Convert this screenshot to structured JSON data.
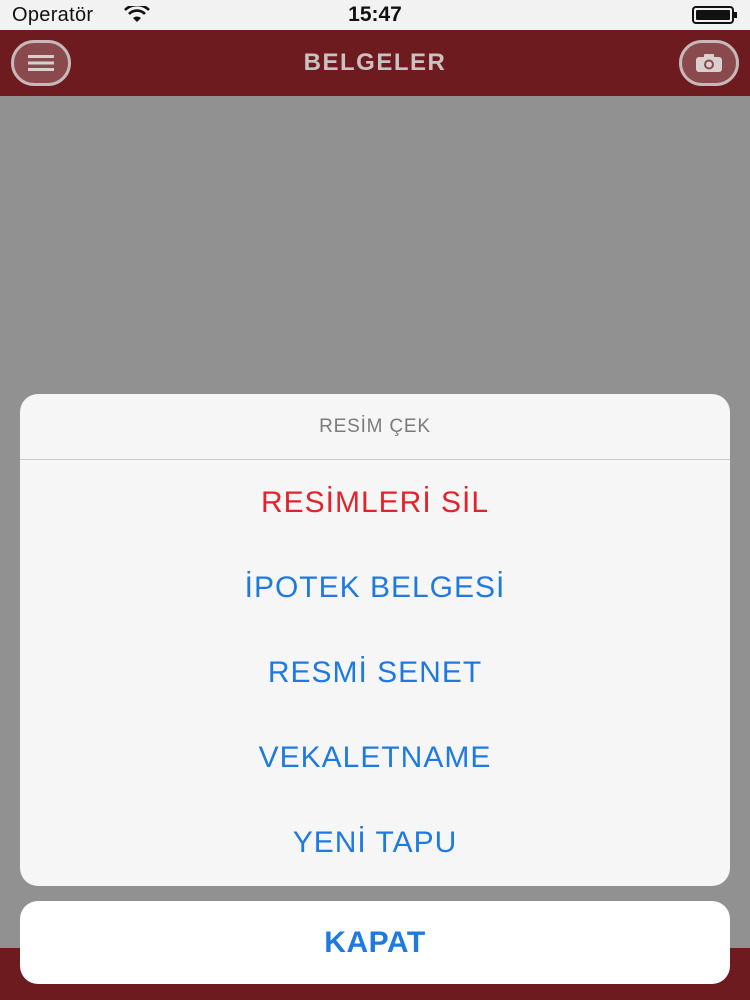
{
  "status_bar": {
    "carrier": "Operatör",
    "time": "15:47",
    "wifi_icon": "wifi-icon",
    "battery_icon": "battery-icon"
  },
  "nav_bar": {
    "title": "BELGELER",
    "left_icon": "menu-icon",
    "right_icon": "camera-icon",
    "background_color": "#6e1b1f"
  },
  "action_sheet": {
    "title": "RESİM ÇEK",
    "items": [
      {
        "label": "RESİMLERİ SİL",
        "style": "destructive"
      },
      {
        "label": "İPOTEK BELGESİ",
        "style": "default"
      },
      {
        "label": "RESMİ SENET",
        "style": "default"
      },
      {
        "label": "VEKALETNAME",
        "style": "default"
      },
      {
        "label": "YENİ TAPU",
        "style": "default"
      }
    ],
    "cancel_label": "KAPAT",
    "colors": {
      "default": "#1f7ae0",
      "destructive": "#e1242b"
    }
  }
}
